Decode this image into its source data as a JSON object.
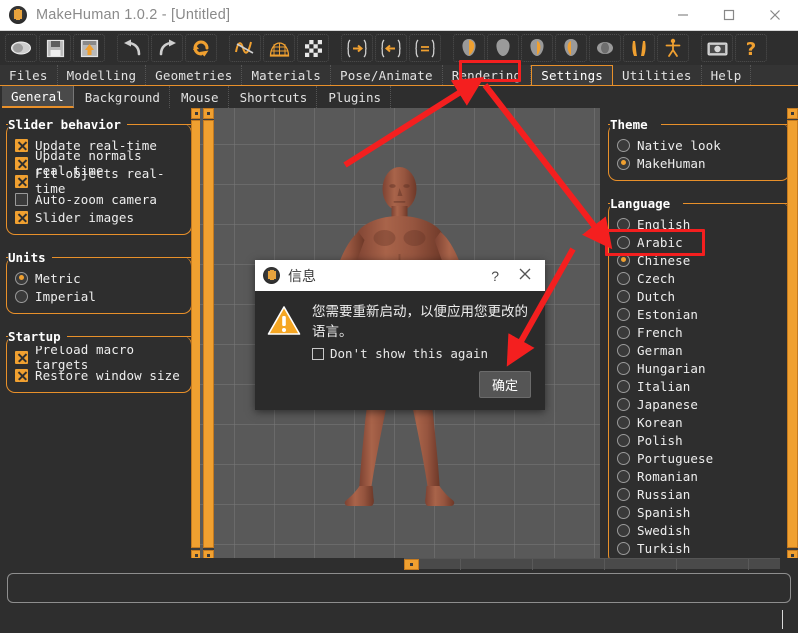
{
  "window": {
    "title": "MakeHuman 1.0.2 - [Untitled]",
    "logo_icon": "makehuman-logo-icon",
    "minimize_label": "—",
    "maximize_label": "☐",
    "close_label": "✕"
  },
  "toolbar": {
    "items": [
      {
        "name": "new-icon",
        "label": "New"
      },
      {
        "name": "save-icon",
        "label": "Save"
      },
      {
        "name": "load-icon",
        "label": "Load"
      },
      {
        "name": "undo-icon",
        "label": "Undo"
      },
      {
        "name": "redo-icon",
        "label": "Redo"
      },
      {
        "name": "reset-mesh-icon",
        "label": "Reset mesh"
      },
      {
        "name": "smooth-icon",
        "label": "Smooth"
      },
      {
        "name": "wireframe-icon",
        "label": "Wireframe"
      },
      {
        "name": "subdivide-icon",
        "label": "Subdivide"
      },
      {
        "name": "symmetry-right-icon",
        "label": "Symmetry right"
      },
      {
        "name": "symmetry-left-icon",
        "label": "Symmetry left"
      },
      {
        "name": "symmetry-icon",
        "label": "Symmetry"
      },
      {
        "name": "view-front-icon",
        "label": "Front view"
      },
      {
        "name": "view-back-icon",
        "label": "Back view"
      },
      {
        "name": "view-left-icon",
        "label": "Left view"
      },
      {
        "name": "view-right-icon",
        "label": "Right view"
      },
      {
        "name": "view-top-icon",
        "label": "Top view"
      },
      {
        "name": "view-bottom-icon",
        "label": "Bottom view"
      },
      {
        "name": "global-camera-icon",
        "label": "Global camera"
      },
      {
        "name": "grab-screen-icon",
        "label": "Grab screen"
      },
      {
        "name": "help-icon",
        "label": "Help"
      }
    ]
  },
  "main_tabs": [
    {
      "label": "Files",
      "active": false
    },
    {
      "label": "Modelling",
      "active": false
    },
    {
      "label": "Geometries",
      "active": false
    },
    {
      "label": "Materials",
      "active": false
    },
    {
      "label": "Pose/Animate",
      "active": false
    },
    {
      "label": "Rendering",
      "active": false
    },
    {
      "label": "Settings",
      "active": true
    },
    {
      "label": "Utilities",
      "active": false
    },
    {
      "label": "Help",
      "active": false
    }
  ],
  "sub_tabs": [
    {
      "label": "General",
      "active": true
    },
    {
      "label": "Background",
      "active": false
    },
    {
      "label": "Mouse",
      "active": false
    },
    {
      "label": "Shortcuts",
      "active": false
    },
    {
      "label": "Plugins",
      "active": false
    }
  ],
  "left_panel": {
    "slider_behavior": {
      "title": "Slider behavior",
      "options": [
        {
          "label": "Update real-time",
          "checked": true
        },
        {
          "label": "Update normals real-time",
          "checked": true
        },
        {
          "label": "Fit objects real-time",
          "checked": true
        },
        {
          "label": "Auto-zoom camera",
          "checked": false
        },
        {
          "label": "Slider images",
          "checked": true
        }
      ]
    },
    "units": {
      "title": "Units",
      "options": [
        {
          "label": "Metric",
          "selected": true
        },
        {
          "label": "Imperial",
          "selected": false
        }
      ]
    },
    "startup": {
      "title": "Startup",
      "options": [
        {
          "label": "Preload macro targets",
          "checked": true
        },
        {
          "label": "Restore window size",
          "checked": true
        }
      ]
    }
  },
  "right_panel": {
    "theme": {
      "title": "Theme",
      "options": [
        {
          "label": "Native look",
          "selected": false
        },
        {
          "label": "MakeHuman",
          "selected": true
        }
      ]
    },
    "language": {
      "title": "Language",
      "options": [
        {
          "label": "English",
          "selected": false
        },
        {
          "label": "Arabic",
          "selected": false
        },
        {
          "label": "Chinese",
          "selected": true
        },
        {
          "label": "Czech",
          "selected": false
        },
        {
          "label": "Dutch",
          "selected": false
        },
        {
          "label": "Estonian",
          "selected": false
        },
        {
          "label": "French",
          "selected": false
        },
        {
          "label": "German",
          "selected": false
        },
        {
          "label": "Hungarian",
          "selected": false
        },
        {
          "label": "Italian",
          "selected": false
        },
        {
          "label": "Japanese",
          "selected": false
        },
        {
          "label": "Korean",
          "selected": false
        },
        {
          "label": "Polish",
          "selected": false
        },
        {
          "label": "Portuguese",
          "selected": false
        },
        {
          "label": "Romanian",
          "selected": false
        },
        {
          "label": "Russian",
          "selected": false
        },
        {
          "label": "Spanish",
          "selected": false
        },
        {
          "label": "Swedish",
          "selected": false
        },
        {
          "label": "Turkish",
          "selected": false
        }
      ]
    }
  },
  "viewport": {
    "model_name": "human-figure-model"
  },
  "dialog": {
    "title": "信息",
    "logo_icon": "makehuman-logo-icon",
    "help_label": "?",
    "close_label": "✕",
    "warning_icon": "warning-triangle-icon",
    "message": "您需要重新启动，以便应用您更改的语言。",
    "dont_show_label": "Don't show this again",
    "dont_show_checked": false,
    "ok_label": "确定"
  },
  "annotations": {
    "highlight_color": "#f41f1f",
    "boxes": [
      "settings-tab",
      "chinese-radio"
    ],
    "arrows": [
      "arrow-to-settings-tab",
      "arrow-to-chinese-option",
      "arrow-to-ok-button"
    ]
  },
  "status_bar": {
    "text": ""
  },
  "colors": {
    "accent": "#f0a030",
    "panel_bg": "#2e2e2e",
    "viewport_bg": "#595959",
    "titlebar_bg": "#ffffff",
    "highlight": "#f41f1f"
  }
}
